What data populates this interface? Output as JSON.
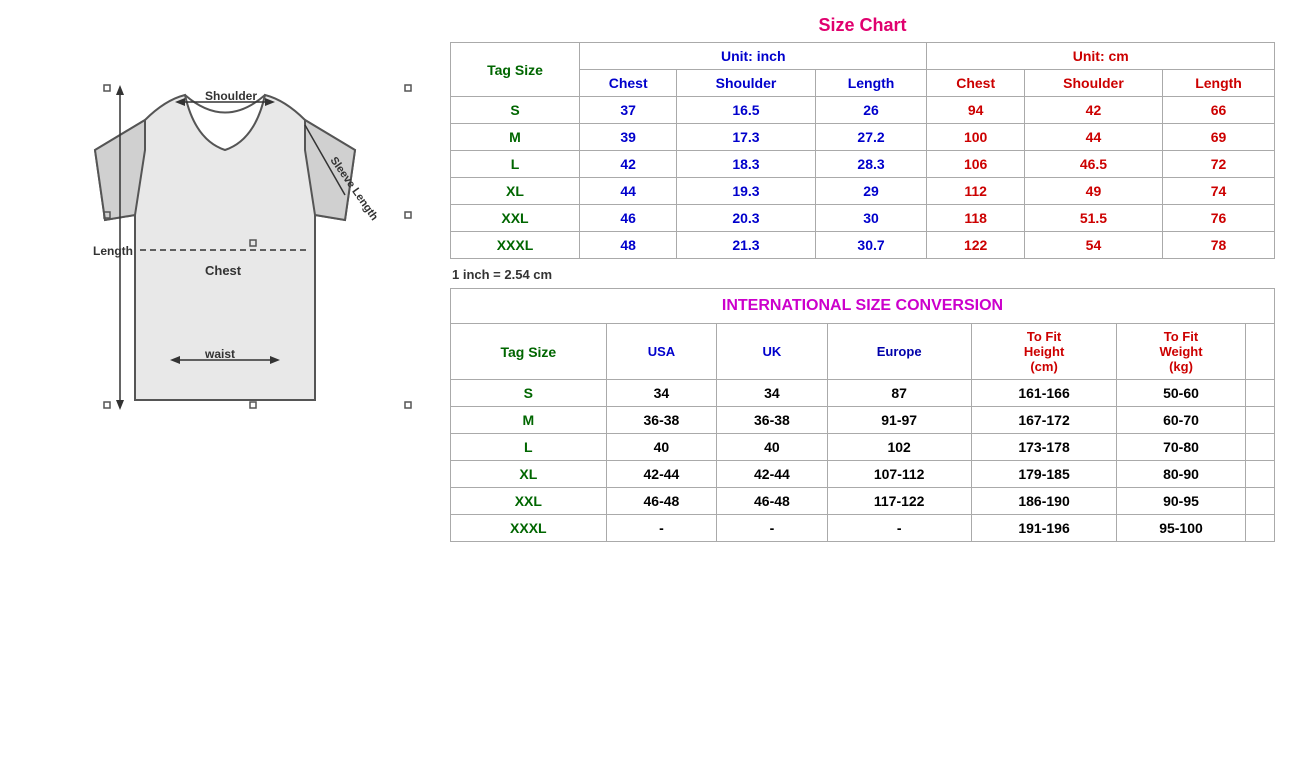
{
  "title": "Size Chart",
  "conversionTitle": "INTERNATIONAL SIZE CONVERSION",
  "note": "1 inch = 2.54 cm",
  "sizeChart": {
    "unitInch": "Unit: inch",
    "unitCm": "Unit: cm",
    "headers": {
      "tagSize": "Tag Size",
      "chest": "Chest",
      "shoulder": "Shoulder",
      "length": "Length"
    },
    "rows": [
      {
        "tag": "S",
        "inchChest": "37",
        "inchShoulder": "16.5",
        "inchLength": "26",
        "cmChest": "94",
        "cmShoulder": "42",
        "cmLength": "66"
      },
      {
        "tag": "M",
        "inchChest": "39",
        "inchShoulder": "17.3",
        "inchLength": "27.2",
        "cmChest": "100",
        "cmShoulder": "44",
        "cmLength": "69"
      },
      {
        "tag": "L",
        "inchChest": "42",
        "inchShoulder": "18.3",
        "inchLength": "28.3",
        "cmChest": "106",
        "cmShoulder": "46.5",
        "cmLength": "72"
      },
      {
        "tag": "XL",
        "inchChest": "44",
        "inchShoulder": "19.3",
        "inchLength": "29",
        "cmChest": "112",
        "cmShoulder": "49",
        "cmLength": "74"
      },
      {
        "tag": "XXL",
        "inchChest": "46",
        "inchShoulder": "20.3",
        "inchLength": "30",
        "cmChest": "118",
        "cmShoulder": "51.5",
        "cmLength": "76"
      },
      {
        "tag": "XXXL",
        "inchChest": "48",
        "inchShoulder": "21.3",
        "inchLength": "30.7",
        "cmChest": "122",
        "cmShoulder": "54",
        "cmLength": "78"
      }
    ]
  },
  "conversion": {
    "headers": {
      "tagSize": "Tag Size",
      "usa": "USA",
      "uk": "UK",
      "europe": "Europe",
      "toFitHeight": "To Fit Height (cm)",
      "toFitWeight": "To Fit Weight (kg)"
    },
    "rows": [
      {
        "tag": "S",
        "usa": "34",
        "uk": "34",
        "europe": "87",
        "height": "161-166",
        "weight": "50-60"
      },
      {
        "tag": "M",
        "usa": "36-38",
        "uk": "36-38",
        "europe": "91-97",
        "height": "167-172",
        "weight": "60-70"
      },
      {
        "tag": "L",
        "usa": "40",
        "uk": "40",
        "europe": "102",
        "height": "173-178",
        "weight": "70-80"
      },
      {
        "tag": "XL",
        "usa": "42-44",
        "uk": "42-44",
        "europe": "107-112",
        "height": "179-185",
        "weight": "80-90"
      },
      {
        "tag": "XXL",
        "usa": "46-48",
        "uk": "46-48",
        "europe": "117-122",
        "height": "186-190",
        "weight": "90-95"
      },
      {
        "tag": "XXXL",
        "usa": "-",
        "uk": "-",
        "europe": "-",
        "height": "191-196",
        "weight": "95-100"
      }
    ]
  }
}
